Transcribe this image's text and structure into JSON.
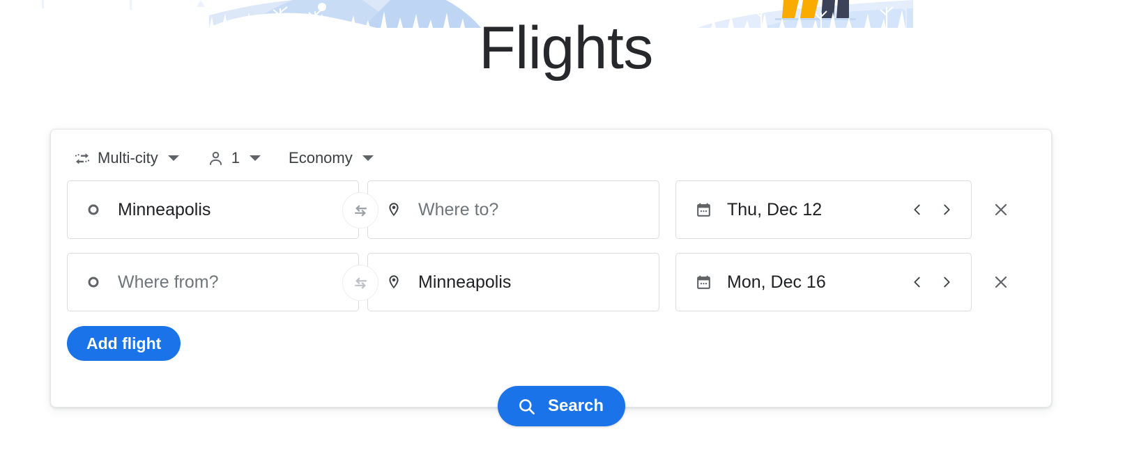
{
  "page": {
    "title": "Flights"
  },
  "hero": {
    "name": "flights-header-illustration",
    "colors": {
      "sky_light": "#eef3fc",
      "mountain_mid": "#dce7f8",
      "mountain_deep": "#c5d9f5",
      "snow": "#ffffff",
      "sail_yellow": "#f9ab00",
      "sail_navy": "#3c4257"
    }
  },
  "options": {
    "trip_type": {
      "icon": "multi-city-icon",
      "label": "Multi-city",
      "caret": "chevron-down-icon"
    },
    "passengers": {
      "icon": "person-icon",
      "label": "1",
      "caret": "chevron-down-icon"
    },
    "cabin_class": {
      "label": "Economy",
      "caret": "chevron-down-icon"
    }
  },
  "flights": [
    {
      "origin": {
        "icon": "origin-circle-icon",
        "value": "Minneapolis",
        "placeholder": "Where from?",
        "is_placeholder": false
      },
      "swap": {
        "icon": "swap-arrows-icon"
      },
      "destination": {
        "icon": "map-pin-icon",
        "value": "Where to?",
        "placeholder": "Where to?",
        "is_placeholder": true
      },
      "date": {
        "icon": "calendar-icon",
        "value": "Thu, Dec 12",
        "prev_icon": "chevron-left-icon",
        "next_icon": "chevron-right-icon"
      },
      "remove": {
        "icon": "close-icon"
      }
    },
    {
      "origin": {
        "icon": "origin-circle-icon",
        "value": "Where from?",
        "placeholder": "Where from?",
        "is_placeholder": true
      },
      "swap": {
        "icon": "swap-arrows-icon"
      },
      "destination": {
        "icon": "map-pin-icon",
        "value": "Minneapolis",
        "placeholder": "Where to?",
        "is_placeholder": false
      },
      "date": {
        "icon": "calendar-icon",
        "value": "Mon, Dec 16",
        "prev_icon": "chevron-left-icon",
        "next_icon": "chevron-right-icon"
      },
      "remove": {
        "icon": "close-icon"
      }
    }
  ],
  "add_flight": {
    "label": "Add flight"
  },
  "search": {
    "icon": "search-icon",
    "label": "Search"
  },
  "colors": {
    "accent_blue": "#1a73e8",
    "text_primary": "#202124",
    "text_secondary": "#3c4043",
    "placeholder": "#70757a",
    "border": "#dadce0"
  }
}
